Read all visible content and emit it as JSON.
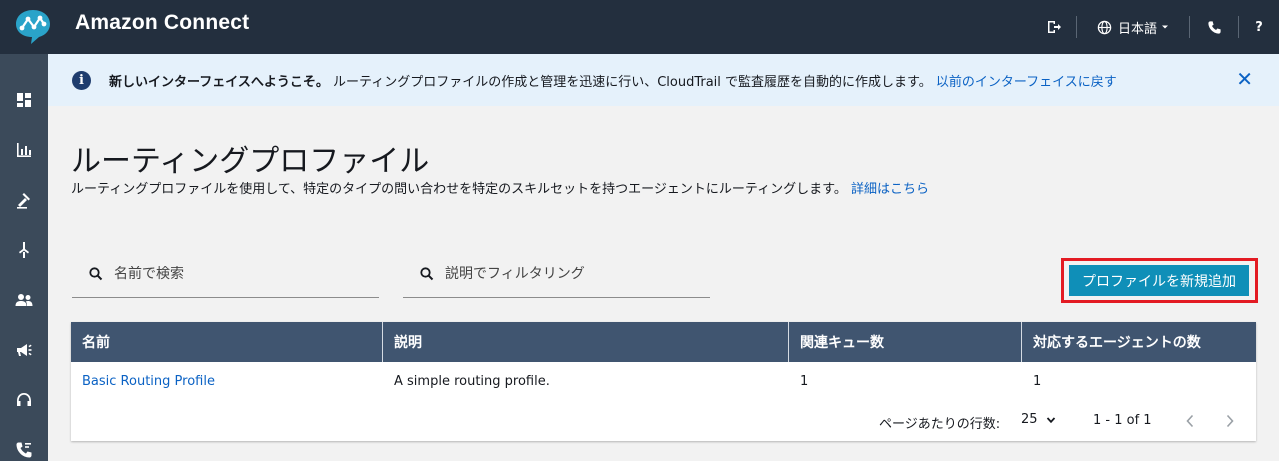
{
  "header": {
    "brand": "Amazon Connect",
    "language": "日本語",
    "help": "?"
  },
  "banner": {
    "title": "新しいインターフェイスへようこそ。",
    "message": "ルーティングプロファイルの作成と管理を迅速に行い、CloudTrail で監査履歴を自動的に作成します。",
    "link": "以前のインターフェイスに戻す",
    "close": "✕"
  },
  "page": {
    "title": "ルーティングプロファイル",
    "description": "ルーティングプロファイルを使用して、特定のタイプの問い合わせを特定のスキルセットを持つエージェントにルーティングします。",
    "details_link": "詳細はこちら"
  },
  "filters": {
    "name_placeholder": "名前で検索",
    "desc_placeholder": "説明でフィルタリング"
  },
  "actions": {
    "add_profile": "プロファイルを新規追加"
  },
  "table": {
    "columns": [
      "名前",
      "説明",
      "関連キュー数",
      "対応するエージェントの数"
    ],
    "rows": [
      {
        "name": "Basic Routing Profile",
        "description": "A simple routing profile.",
        "queues": "1",
        "agents": "1"
      }
    ]
  },
  "pagination": {
    "rows_per_page_label": "ページあたりの行数:",
    "rows_per_page": "25",
    "range": "1 - 1 of 1"
  },
  "sidebar": {
    "items": [
      "dashboard-icon",
      "metrics-icon",
      "routing-icon",
      "flows-icon",
      "users-icon",
      "campaigns-icon",
      "headset-icon",
      "phone-icon"
    ]
  },
  "colors": {
    "topbar": "#232f3e",
    "sidebar": "#3b4a5a",
    "banner": "#e5f1fb",
    "link": "#0b62c4",
    "primary": "#0f8fb8",
    "table_header": "#405570",
    "highlight": "#e31b23"
  }
}
